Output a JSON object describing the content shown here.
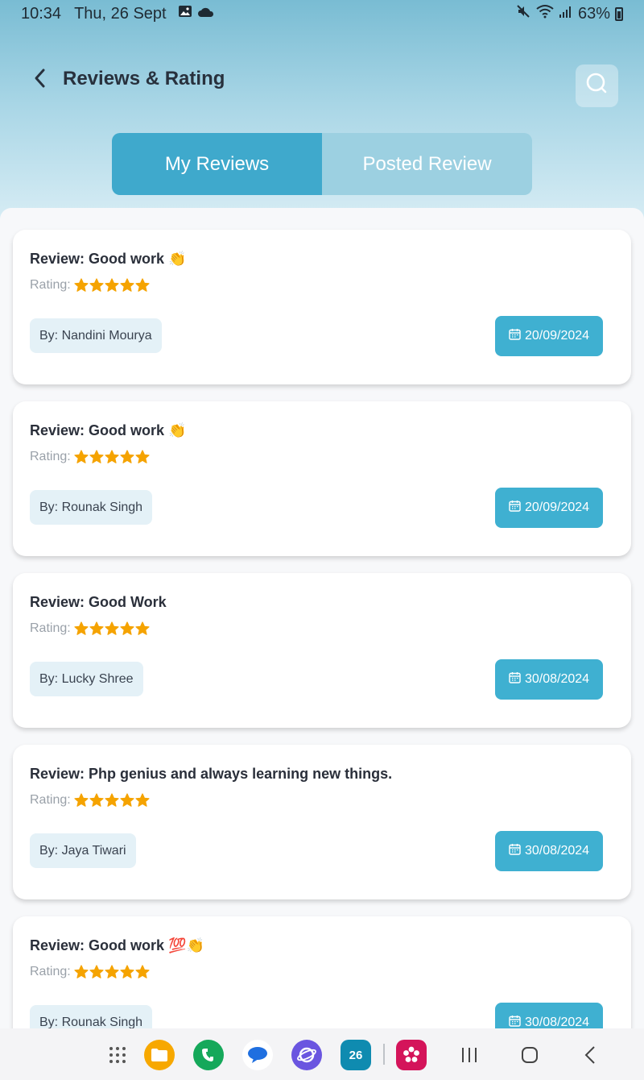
{
  "status_bar": {
    "time": "10:34",
    "date": "Thu, 26 Sept",
    "battery": "63%",
    "icons": [
      "image-icon",
      "cloud-icon",
      "mute-icon",
      "wifi-icon",
      "signal-icon",
      "battery-icon"
    ]
  },
  "header": {
    "title": "Reviews & Rating",
    "back_icon": "chevron-left-icon",
    "search_icon": "search-icon"
  },
  "tabs": [
    {
      "label": "My Reviews",
      "active": true
    },
    {
      "label": "Posted Review",
      "active": false
    }
  ],
  "reviews": [
    {
      "title": "Review: Good work 👏",
      "rating_label": "Rating:",
      "stars": 5,
      "author": "By: Nandini Mourya",
      "date": "20/09/2024"
    },
    {
      "title": "Review: Good work 👏",
      "rating_label": "Rating:",
      "stars": 5,
      "author": "By: Rounak Singh",
      "date": "20/09/2024"
    },
    {
      "title": "Review: Good Work",
      "rating_label": "Rating:",
      "stars": 5,
      "author": "By: Lucky Shree",
      "date": "30/08/2024"
    },
    {
      "title": "Review: Php genius and always learning new things.",
      "rating_label": "Rating:",
      "stars": 5,
      "author": "By: Jaya Tiwari",
      "date": "30/08/2024"
    },
    {
      "title": "Review: Good work 💯👏",
      "rating_label": "Rating:",
      "stars": 5,
      "author": "By: Rounak Singh",
      "date": "30/08/2024"
    }
  ],
  "colors": {
    "accent": "#3fb0d1",
    "tab_active": "#3fa9cc",
    "tab_inactive": "#9cd0e1",
    "star": "#f5a300",
    "author_bg": "#e4f1f7"
  },
  "nav_bar": {
    "apps": [
      "apps-grid-icon",
      "files-icon",
      "phone-icon",
      "messages-icon",
      "browser-icon",
      "calendar-icon",
      "gallery-icon"
    ],
    "calendar_day": "26",
    "system": [
      "recents-icon",
      "home-icon",
      "back-icon"
    ]
  }
}
